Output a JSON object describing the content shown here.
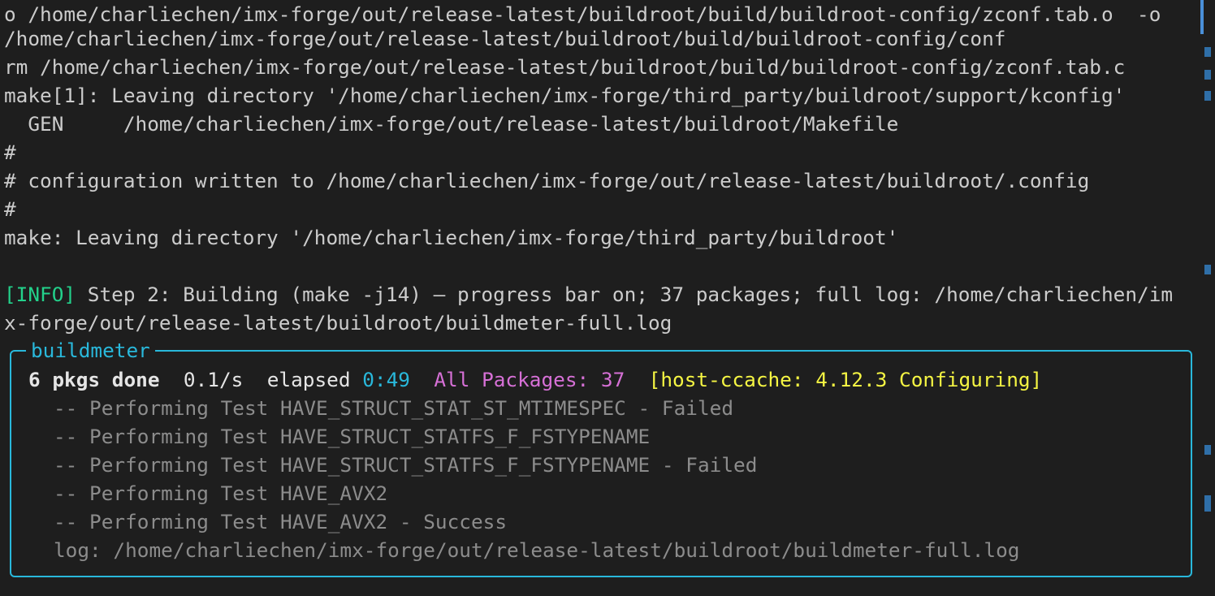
{
  "terminal": {
    "lines": [
      "o /home/charliechen/imx-forge/out/release-latest/buildroot/build/buildroot-config/zconf.tab.o  -o",
      "/home/charliechen/imx-forge/out/release-latest/buildroot/build/buildroot-config/conf",
      "rm /home/charliechen/imx-forge/out/release-latest/buildroot/build/buildroot-config/zconf.tab.c",
      "make[1]: Leaving directory '/home/charliechen/imx-forge/third_party/buildroot/support/kconfig'",
      "  GEN     /home/charliechen/imx-forge/out/release-latest/buildroot/Makefile",
      "#",
      "# configuration written to /home/charliechen/imx-forge/out/release-latest/buildroot/.config",
      "#",
      "make: Leaving directory '/home/charliechen/imx-forge/third_party/buildroot'"
    ],
    "info": {
      "tag": "[INFO]",
      "text": " Step 2: Building (make -j14) — progress bar on; 37 packages; full log: /home/charliechen/im",
      "wrap": "x-forge/out/release-latest/buildroot/buildmeter-full.log"
    }
  },
  "buildmeter": {
    "title": "buildmeter",
    "status": {
      "done": "6 pkgs done",
      "rate": "0.1/s",
      "elapsed_label": "elapsed",
      "elapsed_value": "0:49",
      "packages": "All Packages: 37",
      "current": "[host-ccache: 4.12.3 Configuring]"
    },
    "log_lines": [
      "-- Performing Test HAVE_STRUCT_STAT_ST_MTIMESPEC - Failed",
      "-- Performing Test HAVE_STRUCT_STATFS_F_FSTYPENAME",
      "-- Performing Test HAVE_STRUCT_STATFS_F_FSTYPENAME - Failed",
      "-- Performing Test HAVE_AVX2",
      "-- Performing Test HAVE_AVX2 - Success"
    ],
    "log_path": "log: /home/charliechen/imx-forge/out/release-latest/buildroot/buildmeter-full.log"
  },
  "colors": {
    "background": "#1e1e1e",
    "info": "#23d18b",
    "cyan": "#29b8db",
    "magenta": "#d670d6",
    "yellow": "#f5f543",
    "dim": "#8c8c8c"
  }
}
